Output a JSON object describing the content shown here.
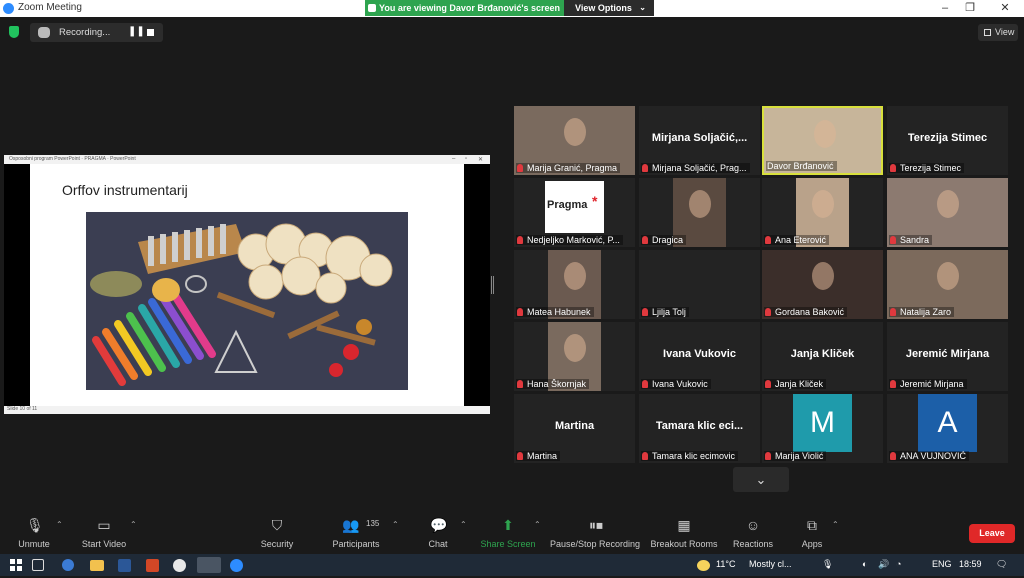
{
  "window": {
    "title": "Zoom Meeting"
  },
  "banner": {
    "viewing": "You are viewing Davor Brđanović's screen",
    "view_options": "View Options"
  },
  "recording": {
    "label": "Recording..."
  },
  "view_button": {
    "label": "View"
  },
  "shared_screen": {
    "pp_title": "Osposobni program PowerPoint · PRAGMA · PowerPoint",
    "slide_title": "Orffov instrumentarij",
    "slide_status": "Slide 10 of 11"
  },
  "participants": [
    {
      "name": "Marija Granić, Pragma",
      "display": "",
      "video": true,
      "muted": true
    },
    {
      "name": "Mirjana Soljačić, Prag...",
      "display": "Mirjana  Soljačić,...",
      "video": false,
      "muted": true
    },
    {
      "name": "Davor Brđanović",
      "display": "",
      "video": true,
      "muted": false,
      "active": true
    },
    {
      "name": "Terezija Stimec",
      "display": "Terezija Stimec",
      "video": false,
      "muted": true
    },
    {
      "name": "Nedjeljko Marković, P...",
      "display": "",
      "video": false,
      "muted": true,
      "logo": "Pragma"
    },
    {
      "name": "Dragica",
      "display": "",
      "video": true,
      "muted": true
    },
    {
      "name": "Ana Eterović",
      "display": "",
      "video": true,
      "muted": true
    },
    {
      "name": "Sandra",
      "display": "",
      "video": true,
      "muted": true
    },
    {
      "name": "Matea Habunek",
      "display": "",
      "video": true,
      "muted": true
    },
    {
      "name": "Ljilja Tolj",
      "display": "",
      "video": false,
      "muted": true
    },
    {
      "name": "Gordana Baković",
      "display": "",
      "video": true,
      "muted": true
    },
    {
      "name": "Natalija Zaro",
      "display": "",
      "video": true,
      "muted": true
    },
    {
      "name": "Hana Škornjak",
      "display": "",
      "video": true,
      "muted": true
    },
    {
      "name": "Ivana Vukovic",
      "display": "Ivana Vukovic",
      "video": false,
      "muted": true
    },
    {
      "name": "Janja Kliček",
      "display": "Janja Kliček",
      "video": false,
      "muted": true
    },
    {
      "name": "Jeremić Mirjana",
      "display": "Jeremić Mirjana",
      "video": false,
      "muted": true
    },
    {
      "name": "Martina",
      "display": "Martina",
      "video": false,
      "muted": true
    },
    {
      "name": "Tamara klic ecimovic",
      "display": "Tamara klic eci...",
      "video": false,
      "muted": true
    },
    {
      "name": "Marija Violić",
      "display": "",
      "video": false,
      "muted": true,
      "avatar": "M",
      "avatar_color": "#1f9bab"
    },
    {
      "name": "ANA VUJNOVIĆ",
      "display": "",
      "video": false,
      "muted": true,
      "avatar": "A",
      "avatar_color": "#1c5fa8"
    }
  ],
  "toolbar": {
    "unmute": "Unmute",
    "start_video": "Start Video",
    "security": "Security",
    "participants": "Participants",
    "participants_count": "135",
    "chat": "Chat",
    "share_screen": "Share Screen",
    "pause_recording": "Pause/Stop Recording",
    "breakout": "Breakout Rooms",
    "reactions": "Reactions",
    "apps": "Apps",
    "leave": "Leave"
  },
  "taskbar": {
    "weather": "11°C",
    "weather_desc": "Mostly cl...",
    "lang": "ENG",
    "time": "18:59"
  },
  "colors": {
    "accent": "#2d8cff",
    "green": "#2ea44f",
    "leave": "#e02828",
    "active_speaker": "#d8e03c"
  }
}
